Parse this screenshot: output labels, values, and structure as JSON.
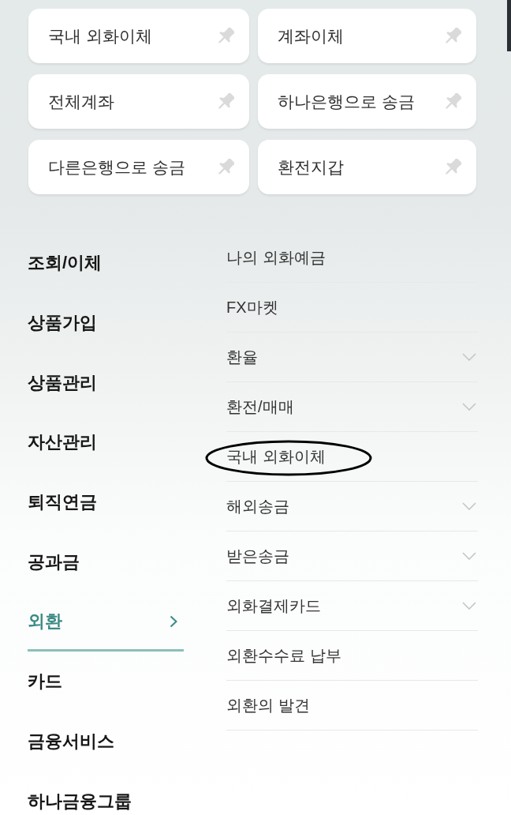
{
  "favorites": [
    {
      "label": "국내 외화이체",
      "pinned": false
    },
    {
      "label": "계좌이체",
      "pinned": false
    },
    {
      "label": "전체계좌",
      "pinned": false
    },
    {
      "label": "하나은행으로 송금",
      "pinned": false
    },
    {
      "label": "다른은행으로 송금",
      "pinned": false
    },
    {
      "label": "환전지갑",
      "pinned": false
    }
  ],
  "menu": {
    "categories": [
      {
        "label": "조회/이체",
        "selected": false
      },
      {
        "label": "상품가입",
        "selected": false
      },
      {
        "label": "상품관리",
        "selected": false
      },
      {
        "label": "자산관리",
        "selected": false
      },
      {
        "label": "퇴직연금",
        "selected": false
      },
      {
        "label": "공과금",
        "selected": false
      },
      {
        "label": "외환",
        "selected": true
      },
      {
        "label": "카드",
        "selected": false
      },
      {
        "label": "금융서비스",
        "selected": false
      },
      {
        "label": "하나금융그룹",
        "selected": false
      }
    ],
    "subitems": [
      {
        "label": "나의 외화예금",
        "kind": "link",
        "circled": false
      },
      {
        "label": "FX마켓",
        "kind": "link",
        "circled": false
      },
      {
        "label": "환율",
        "kind": "group",
        "circled": false
      },
      {
        "label": "환전/매매",
        "kind": "group",
        "circled": false
      },
      {
        "label": "국내 외화이체",
        "kind": "link",
        "circled": true
      },
      {
        "label": "해외송금",
        "kind": "group",
        "circled": false
      },
      {
        "label": "받은송금",
        "kind": "group",
        "circled": false
      },
      {
        "label": "외화결제카드",
        "kind": "group",
        "circled": false
      },
      {
        "label": "외환수수료 납부",
        "kind": "link",
        "circled": false
      },
      {
        "label": "외환의 발견",
        "kind": "link",
        "circled": false
      }
    ]
  }
}
